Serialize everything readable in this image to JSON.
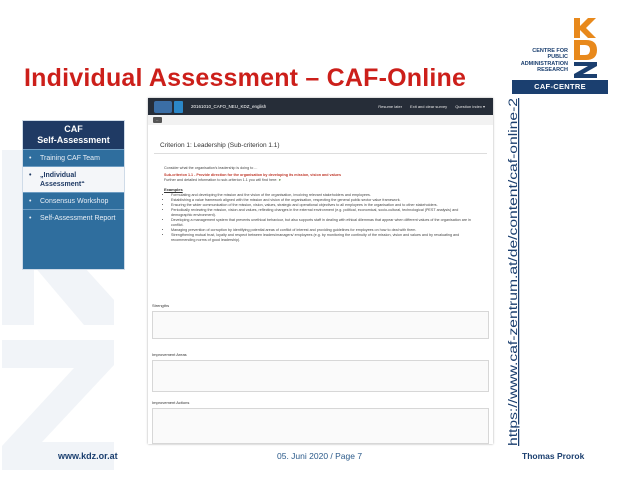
{
  "slide": {
    "title": "Individual Assessment – CAF-Online",
    "url": "https://www.caf-zentrum.at/de/content/caf-online-2",
    "footer_left": "www.kdz.or.at",
    "footer_center": "05. Juni 2020 / Page 7",
    "footer_right": "Thomas Prorok"
  },
  "logo": {
    "line1": "CENTRE FOR",
    "line2": "PUBLIC",
    "line3": "ADMINISTRATION",
    "line4": "RESEARCH",
    "badge": "CAF-CENTRE",
    "mark": "KDZ",
    "icon": "kdz-logo-icon"
  },
  "sidebar": {
    "header_line1": "CAF",
    "header_line2": "Self-Assessment",
    "items": [
      {
        "label": "Training CAF Team"
      },
      {
        "label": "„Individual Assessment“",
        "active": true
      },
      {
        "label": "Consensus Workshop"
      },
      {
        "label": "Self-Assessment Report"
      }
    ]
  },
  "screenshot": {
    "survey_title": "20161010_CAFO_NEU_KDZ_english",
    "actions": [
      "Resume later",
      "Exit and clear survey",
      "Question index ▾"
    ],
    "back_icon": "back-icon",
    "criterion_title": "Criterion 1: Leadership (Sub-criterion 1.1)",
    "intro": "Consider what the organisation's leadership is doing to ...",
    "subcriterion": "Sub-criterion 1.1 - Provide direction for the organisation by developing its mission, vision and values",
    "further": "Further and detailed information to sub-criterion 1.1 you will find here:",
    "examples_label": "Examples",
    "examples": [
      "Formulating and developing the mission and the vision of the organisation, involving relevant stakeholders and employees.",
      "Establishing a value framework aligned with the mission and vision of the organisation, respecting the general public sector value framework.",
      "Ensuring the wider communication of the mission, vision, values, strategic and operational objectives to all employees in the organisation and to other stakeholders.",
      "Periodically reviewing the mission, vision and values, reflecting changes in the external environment (e.g. political, economical, socio-cultural, technological (PEST analysis) and demographic environment).",
      "Developing a management system that prevents unethical behaviour, but also supports staff in dealing with ethical dilemmas that appear when different values of the organisation are in conflict.",
      "Managing prevention of corruption by identifying potential areas of conflict of interest and providing guidelines for employees on how to deal with them.",
      "Strengthening mutual trust, loyalty and respect between leaders/managers/ employees (e.g. by monitoring the continuity of the mission, vision and values and by revaluating and recommending norms of good leadership)."
    ],
    "strengths_label": "Strengths",
    "improvement_areas_label": "Improvement Areas",
    "improvement_actions_label": "Improvement Actions"
  },
  "colors": {
    "title_red": "#cc1f1a",
    "navy": "#1b3f6f",
    "sidebar_blue": "#2f6e9e",
    "accent_orange": "#e8891c"
  }
}
